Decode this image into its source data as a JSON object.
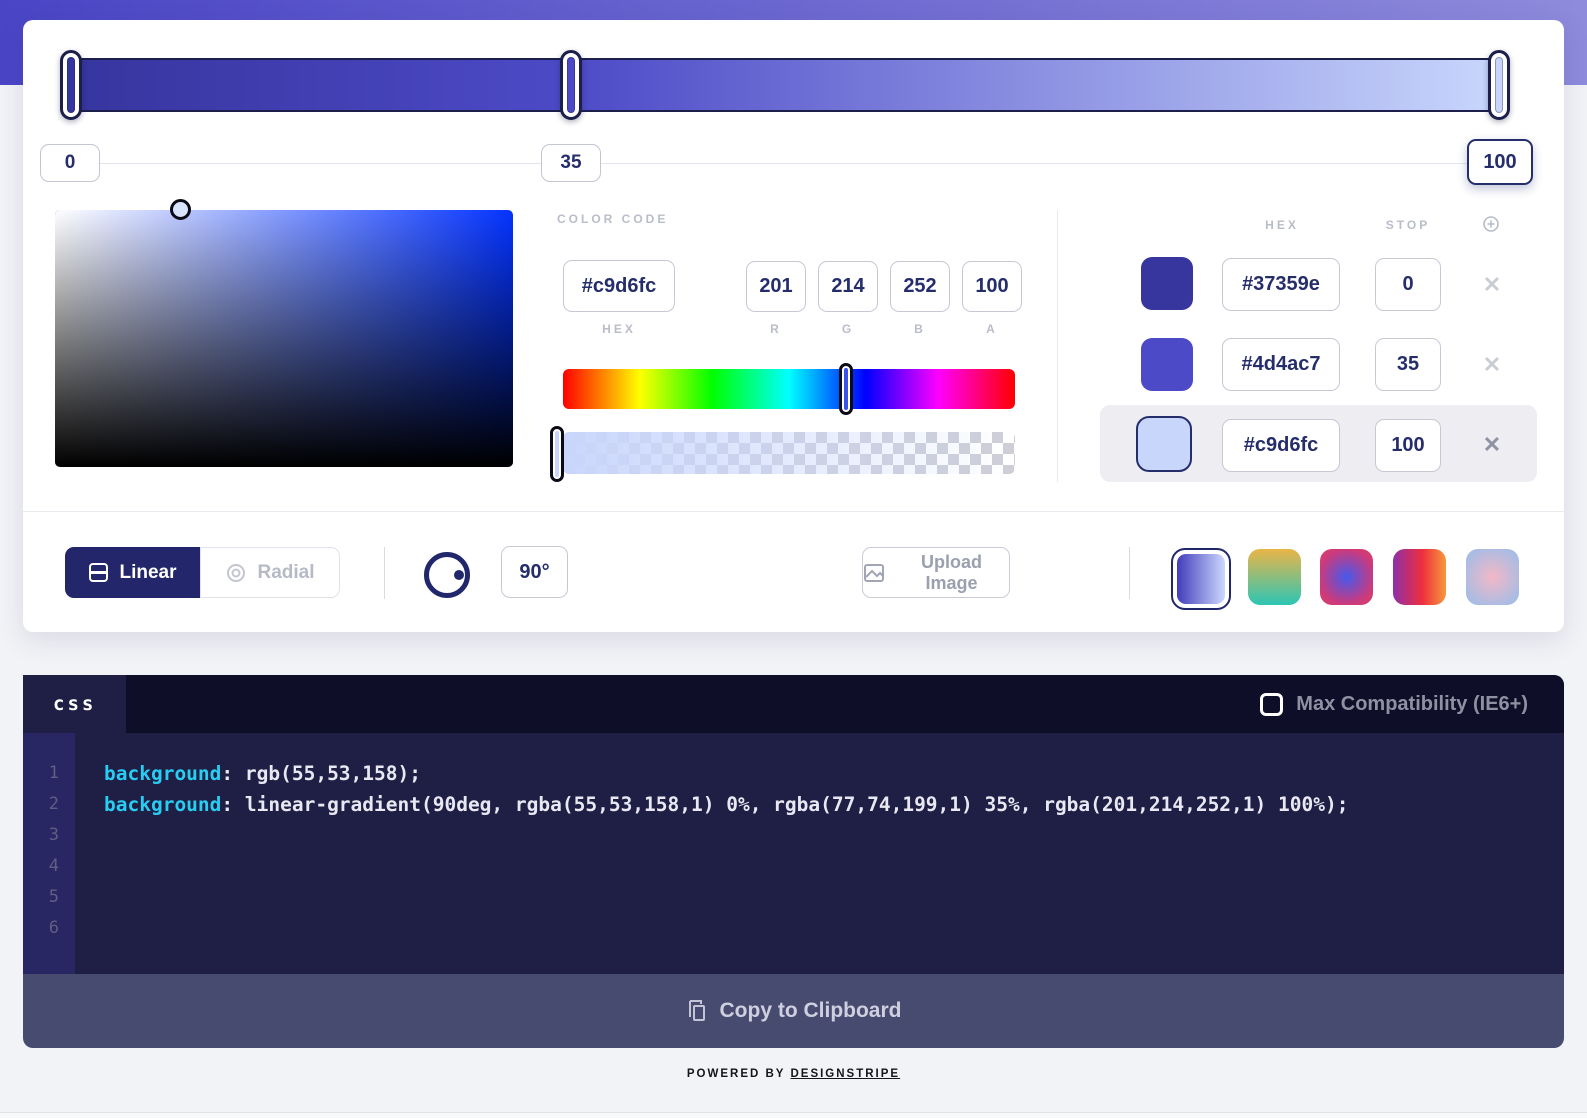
{
  "gradient": {
    "css": "linear-gradient(90deg, #37359e 0%, #4d4ac7 35%, #c9d6fc 100%)",
    "handles": [
      {
        "value": "0",
        "color": "#37359e"
      },
      {
        "value": "35",
        "color": "#4d4ac7"
      },
      {
        "value": "100",
        "color": "#c9d6fc"
      }
    ]
  },
  "picker": {
    "section_label": "COLOR CODE",
    "hex": {
      "value": "#c9d6fc",
      "label": "HEX"
    },
    "rgba": [
      {
        "value": "201",
        "label": "R"
      },
      {
        "value": "214",
        "label": "G"
      },
      {
        "value": "252",
        "label": "B"
      },
      {
        "value": "100",
        "label": "A"
      }
    ],
    "hue_color": "#0433ff",
    "hue_handle_color": "#3b52e6",
    "alpha_overlay": "linear-gradient(90deg, #c9d6fc, rgba(201,214,252,0))",
    "alpha_handle_color": "#c9d6fc"
  },
  "stops_panel": {
    "hex_header": "HEX",
    "stop_header": "STOP",
    "rows": [
      {
        "color": "#37359e",
        "hex": "#37359e",
        "stop": "0",
        "selected": false
      },
      {
        "color": "#4d4ac7",
        "hex": "#4d4ac7",
        "stop": "35",
        "selected": false
      },
      {
        "color": "#c9d6fc",
        "hex": "#c9d6fc",
        "stop": "100",
        "selected": true
      }
    ],
    "delete_symbol": "✕"
  },
  "controls": {
    "linear_label": "Linear",
    "radial_label": "Radial",
    "angle": "90°",
    "upload_label": "Upload Image",
    "presets": [
      {
        "css": "linear-gradient(90deg,#413dbb,#cdd8fd)",
        "selected": true
      },
      {
        "css": "linear-gradient(180deg,#eab547,#2cc5b4)",
        "selected": false
      },
      {
        "css": "radial-gradient(circle at 50% 50%,#4659ec 0%,#cb3a7d 70%,#dd4163 100%)",
        "selected": false
      },
      {
        "css": "linear-gradient(90deg,#8e2fa8 0%,#ee2e3e 55%,#f6983c 100%)",
        "selected": false
      },
      {
        "css": "radial-gradient(circle at 50% 50%,#f2b8c6 0%,#a9bce4 80%)",
        "selected": false
      }
    ]
  },
  "code": {
    "tab": "css",
    "compat_label": "Max Compatibility (IE6+)",
    "line_numbers": [
      "1",
      "2",
      "3",
      "4",
      "5",
      "6"
    ],
    "lines": [
      {
        "property": "background",
        "value": ": rgb(55,53,158);"
      },
      {
        "property": "background",
        "value": ": linear-gradient(90deg, rgba(55,53,158,1) 0%, rgba(77,74,199,1) 35%, rgba(201,214,252,1) 100%);"
      }
    ],
    "copy_label": "Copy to Clipboard"
  },
  "footer": {
    "powered_by": "POWERED BY",
    "brand": "DESIGNSTRIPE"
  },
  "theme": {
    "accent_navy": "#252e6b",
    "keyword_cyan": "#29cdf2",
    "copy_bar": "#484b70"
  }
}
